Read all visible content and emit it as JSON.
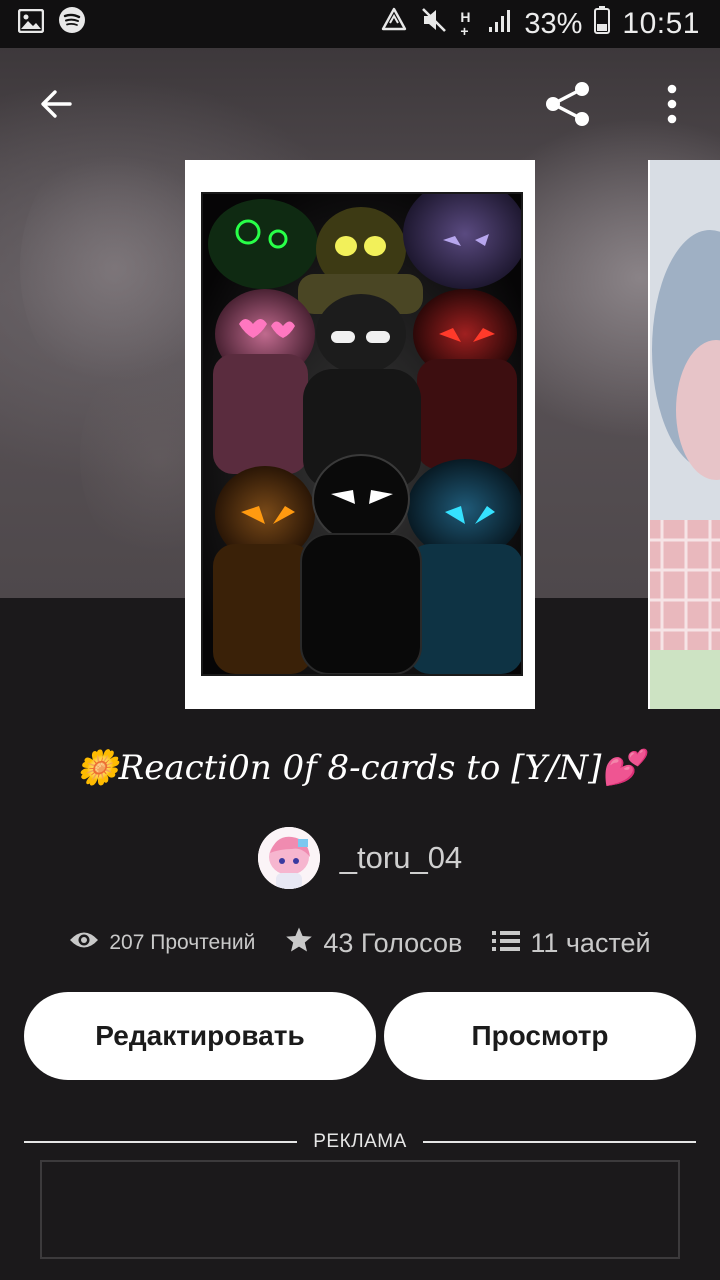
{
  "status_bar": {
    "battery": "33%",
    "time": "10:51",
    "network_label": "H+"
  },
  "toolbar": {
    "back_icon": "arrow-left-icon",
    "share_icon": "share-icon",
    "more_icon": "more-vertical-icon"
  },
  "story": {
    "title": "🌼Reacti0n 0f 8-cards to [Y/N]💕",
    "author": "_toru_04",
    "stats": {
      "reads": "207 Прочтений",
      "votes": "43 Голосов",
      "parts": "11 частей"
    }
  },
  "actions": {
    "edit_label": "Редактировать",
    "view_label": "Просмотр"
  },
  "ad": {
    "label": "РЕКЛАМА"
  },
  "colors": {
    "background": "#1b191b",
    "button_bg": "#ffffff",
    "button_text": "#1b1b1b",
    "muted_text": "#c9c9c9"
  }
}
